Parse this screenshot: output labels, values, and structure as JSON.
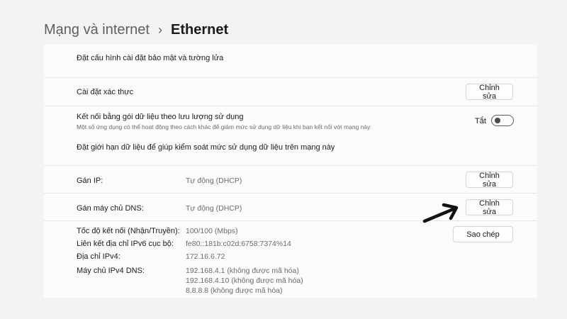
{
  "breadcrumb": {
    "parent": "Mạng và internet",
    "separator": "›",
    "current": "Ethernet"
  },
  "security": {
    "label": "Đặt cấu hình cài đặt bảo mật và tường lửa"
  },
  "auth": {
    "label": "Cài đặt xác thực",
    "button": "Chỉnh sửa"
  },
  "metered": {
    "label": "Kết nối bằng gói dữ liệu theo lưu lượng sử dụng",
    "description": "Một số ứng dụng có thể hoạt động theo cách khác để giảm mức sử dụng dữ liệu khi bạn kết nối với mạng này",
    "toggle_state": "Tắt",
    "toggle_on": false,
    "data_limit_link": "Đặt giới hạn dữ liệu để giúp kiểm soát mức sử dụng dữ liệu trên mạng này"
  },
  "ip_assignment": {
    "label": "Gán IP:",
    "value": "Tự động (DHCP)",
    "button": "Chỉnh sửa"
  },
  "dns_assignment": {
    "label": "Gán máy chủ DNS:",
    "value": "Tự động (DHCP)",
    "button": "Chỉnh sửa"
  },
  "properties": {
    "copy_button": "Sao chép",
    "link_speed_label": "Tốc độ kết nối (Nhận/Truyền):",
    "link_speed_value": "100/100 (Mbps)",
    "ipv6_label": "Liên kết địa chỉ IPv6 cục bộ:",
    "ipv6_value": "fe80::181b:c02d:6758:7374%14",
    "ipv4_label": "Địa chỉ IPv4:",
    "ipv4_value": "172.16.6.72",
    "dns_label": "Máy chủ IPv4 DNS:",
    "dns_values": [
      "192.168.4.1 (không được mã hóa)",
      "192.168.4.10 (không được mã hóa)",
      "8.8.8.8 (không được mã hóa)"
    ]
  },
  "colors": {
    "background": "#f3f3f3",
    "panel": "#fbfbfb",
    "divider": "#e6e6e6",
    "arrow": "#111111"
  },
  "icons": {
    "annotation": "arrow-right-icon"
  }
}
